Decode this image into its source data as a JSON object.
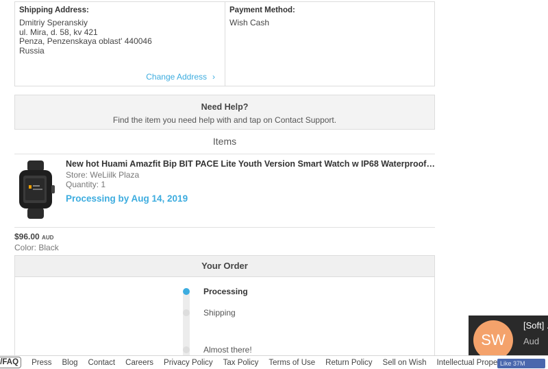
{
  "shipping": {
    "title": "Shipping Address:",
    "lines": [
      "Dmitriy Speranskiy",
      "ul. Mira, d. 58, kv 421",
      "Penza, Penzenskaya oblast' 440046",
      "Russia"
    ],
    "change_label": "Change Address",
    "change_icon": "chevron-right-icon"
  },
  "payment": {
    "title": "Payment Method:",
    "value": "Wish Cash"
  },
  "help": {
    "title": "Need Help?",
    "text": "Find the item you need help with and tap on Contact Support."
  },
  "items_title": "Items",
  "item": {
    "name": "New hot Huami Amazfit Bip BIT PACE Lite Youth Version Smart Watch w IP68 Waterproof ...",
    "store": "Store: WeLiilk Plaza",
    "quantity": "Quantity: 1",
    "status": "Processing by Aug 14, 2019",
    "price": "$96.00",
    "currency": "AUD",
    "color": "Color: Black"
  },
  "order": {
    "title": "Your Order",
    "steps": [
      {
        "label": "Processing",
        "active": true
      },
      {
        "label": "Shipping",
        "active": false
      },
      {
        "label": "Almost there!",
        "active": false
      }
    ],
    "accent": "#3cacdf"
  },
  "footer": {
    "help_faq": "lp/FAQ",
    "links": [
      "Press",
      "Blog",
      "Contact",
      "Careers",
      "Privacy Policy",
      "Tax Policy",
      "Terms of Use",
      "Return Policy",
      "Sell on Wish",
      "Intellectual Property"
    ],
    "like_label": "Like 37M"
  },
  "toast": {
    "avatar_initials": "SW",
    "title": "[Soft] ...",
    "subtitle": "Aud"
  }
}
